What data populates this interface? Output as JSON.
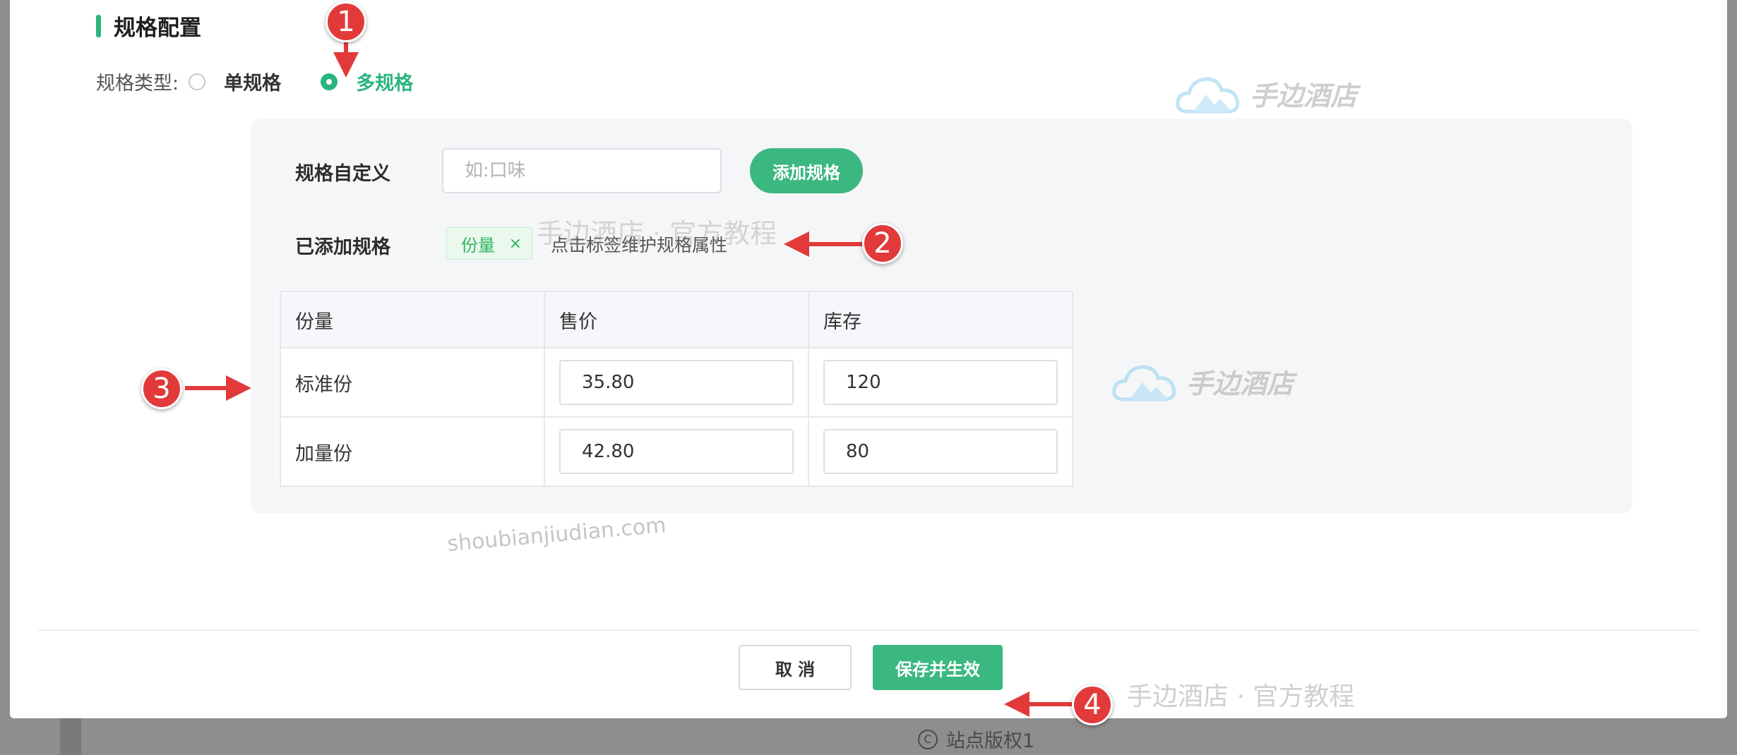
{
  "section": {
    "title": "规格配置"
  },
  "spec_type": {
    "label": "规格类型:",
    "options": [
      {
        "label": "单规格",
        "checked": false
      },
      {
        "label": "多规格",
        "checked": true
      }
    ]
  },
  "custom_spec": {
    "label": "规格自定义",
    "placeholder": "如:口味",
    "add_button": "添加规格"
  },
  "added_specs": {
    "label": "已添加规格",
    "tags": [
      {
        "text": "份量",
        "close": "×"
      }
    ],
    "hint": "点击标签维护规格属性"
  },
  "table": {
    "headers": [
      "份量",
      "售价",
      "库存"
    ],
    "rows": [
      {
        "name": "标准份",
        "price": "35.80",
        "stock": "120"
      },
      {
        "name": "加量份",
        "price": "42.80",
        "stock": "80"
      }
    ]
  },
  "footer": {
    "cancel": "取 消",
    "save": "保存并生效"
  },
  "copyright": {
    "symbol": "C",
    "text": "站点版权1"
  },
  "watermarks": {
    "brand": "手边酒店",
    "center": "手边酒店 · 官方教程",
    "domain": "shoubianjiudian.com",
    "bottom": "手边酒店 · 官方教程"
  },
  "annotations": [
    "1",
    "2",
    "3",
    "4"
  ],
  "colors": {
    "accent": "#3bb87f",
    "annotation": "#e23a3a",
    "tag_bg": "#eaf8ee"
  }
}
